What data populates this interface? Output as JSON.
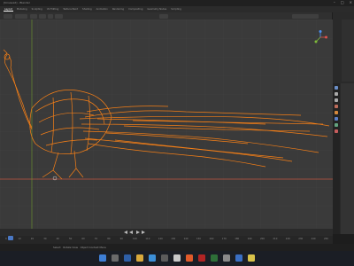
{
  "window": {
    "title": "[Unsaved] - Blender"
  },
  "workspace_tabs": [
    "Layout",
    "Modeling",
    "Sculpting",
    "UV Editing",
    "Texture Paint",
    "Shading",
    "Animation",
    "Rendering",
    "Compositing",
    "Geometry Nodes",
    "Scripting"
  ],
  "viewport": {
    "object": "peacock",
    "display": "wireframe",
    "wire_color": "#f57f17",
    "grid_color": "#3a3a3a",
    "axis_x_color": "#c0563f",
    "axis_y_color": "#6f9b2f"
  },
  "timeline": {
    "current_frame": "1",
    "start": "1",
    "end": "250",
    "ruler": [
      "0",
      "10",
      "20",
      "30",
      "40",
      "50",
      "60",
      "70",
      "80",
      "90",
      "100",
      "110",
      "120",
      "130",
      "140",
      "150",
      "160",
      "170",
      "180",
      "190",
      "200",
      "210",
      "220",
      "230",
      "240",
      "250"
    ]
  },
  "status": {
    "select": "Select",
    "rotate": "Rotate View",
    "context": "Object Context Menu"
  },
  "taskbar": {
    "time": "",
    "date": ""
  }
}
